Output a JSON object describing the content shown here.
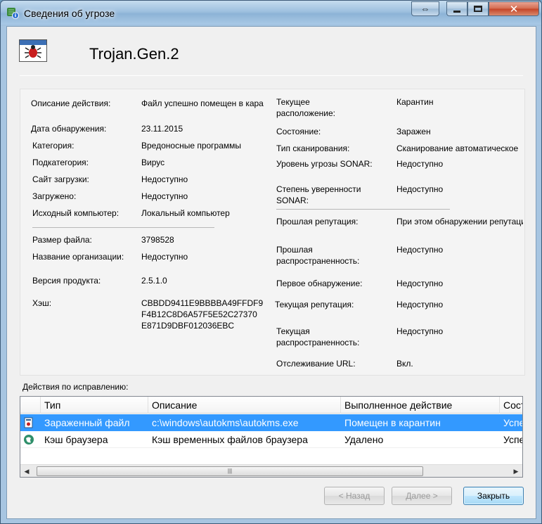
{
  "window": {
    "title": "Сведения об угрозе",
    "colors": {
      "titlebar": "#9ec0df",
      "close_button": "#c44326",
      "selection": "#3399ff"
    }
  },
  "header": {
    "threat_name": "Trojan.Gen.2",
    "icon": "bug-icon"
  },
  "left_fields": [
    {
      "label": "Описание действия:",
      "value": "Файл успешно помещен в карантин"
    },
    {
      "label": "Дата обнаружения:",
      "value": "23.11.2015"
    },
    {
      "label": "Категория:",
      "value": "Вредоносные программы"
    },
    {
      "label": "Подкатегория:",
      "value": "Вирус"
    },
    {
      "label": "Сайт загрузки:",
      "value": "Недоступно"
    },
    {
      "label": "Загружено:",
      "value": "Недоступно"
    },
    {
      "label": "Исходный компьютер:",
      "value": "Локальный компьютер"
    },
    {
      "label": "Размер файла:",
      "value": "3798528"
    },
    {
      "label": "Название организации:",
      "value": "Недоступно"
    },
    {
      "label": "Версия продукта:",
      "value": "2.5.1.0"
    },
    {
      "label": "Хэш:",
      "value": "CBBDD9411E9BBBBA49FFDF9\nF4B12C8D6A57F5E52C27370\nE871D9DBF012036EBC"
    }
  ],
  "right_fields": [
    {
      "label": "Текущее\nрасположение:",
      "value": "Карантин"
    },
    {
      "label": "Состояние:",
      "value": "Заражен"
    },
    {
      "label": "Тип сканирования:",
      "value": "Сканирование автоматическое"
    },
    {
      "label": "Уровень угрозы SONAR:",
      "value": "Недоступно"
    },
    {
      "label": "Степень уверенности\nSONAR:",
      "value": "Недоступно"
    },
    {
      "label": "Прошлая репутация:",
      "value": "При этом обнаружении репутация"
    },
    {
      "label": "Прошлая\nраспространенность:",
      "value": "Недоступно"
    },
    {
      "label": "Первое обнаружение:",
      "value": "Недоступно"
    },
    {
      "label": "Текущая репутация:",
      "value": "Недоступно"
    },
    {
      "label": "Текущая\nраспространенность:",
      "value": "Недоступно"
    },
    {
      "label": "Отслеживание URL:",
      "value": "Вкл."
    }
  ],
  "remediation": {
    "section_label": "Действия по исправлению:",
    "columns": [
      "Тип",
      "Описание",
      "Выполненное действие",
      "Состояние"
    ],
    "rows": [
      {
        "icon": "infected-file-icon",
        "type": "Зараженный файл",
        "description": "c:\\windows\\autokms\\autokms.exe",
        "action": "Помещен в карантин",
        "status": "Успешно",
        "selected": true
      },
      {
        "icon": "browser-cache-icon",
        "type": "Кэш браузера",
        "description": "Кэш временных файлов браузера",
        "action": "Удалено",
        "status": "Успешно",
        "selected": false
      }
    ]
  },
  "buttons": {
    "back": "< Назад",
    "next": "Далее >",
    "close": "Закрыть"
  }
}
